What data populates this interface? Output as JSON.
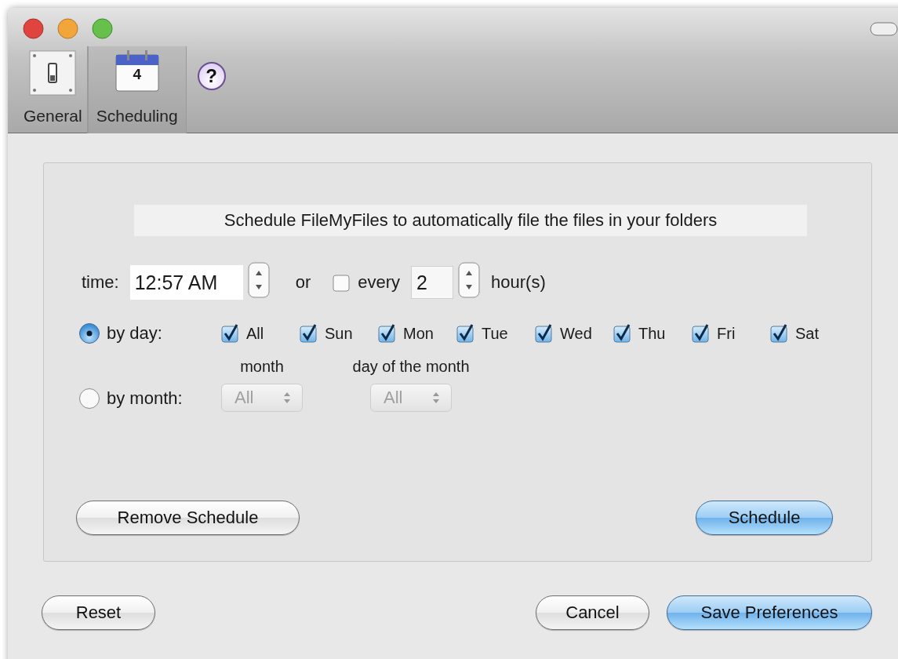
{
  "toolbar": {
    "items": [
      {
        "kind": "switch",
        "label": "General",
        "selected": false
      },
      {
        "kind": "calendar",
        "label": "Scheduling",
        "selected": true,
        "icon_text": "4"
      },
      {
        "kind": "help",
        "label": "?"
      }
    ]
  },
  "schedule": {
    "heading": "Schedule FileMyFiles to automatically file the files in your folders",
    "time": {
      "label": "time:",
      "value": "12:57 AM"
    },
    "or_label": "or",
    "every": {
      "label": "every",
      "checked": false,
      "value": "2",
      "unit": "hour(s)"
    },
    "modes": [
      {
        "kind": "day",
        "label": "by day:",
        "selected": true
      },
      {
        "kind": "month",
        "label": "by month:",
        "selected": false
      }
    ],
    "days": [
      {
        "label": "All",
        "checked": true
      },
      {
        "label": "Sun",
        "checked": true
      },
      {
        "label": "Mon",
        "checked": true
      },
      {
        "label": "Tue",
        "checked": true
      },
      {
        "label": "Wed",
        "checked": true
      },
      {
        "label": "Thu",
        "checked": true
      },
      {
        "label": "Fri",
        "checked": true
      },
      {
        "label": "Sat",
        "checked": true
      }
    ],
    "popups": [
      {
        "caption": "month",
        "value": "All",
        "disabled": true
      },
      {
        "caption": "day of the month",
        "value": "All",
        "disabled": true
      }
    ],
    "buttons": [
      {
        "label": "Remove Schedule",
        "default": false
      },
      {
        "label": "Schedule",
        "default": true
      }
    ]
  },
  "footer": {
    "buttons": [
      {
        "label": "Reset",
        "default": false
      },
      {
        "label": "Cancel",
        "default": false
      },
      {
        "label": "Save Preferences",
        "default": true
      }
    ]
  }
}
